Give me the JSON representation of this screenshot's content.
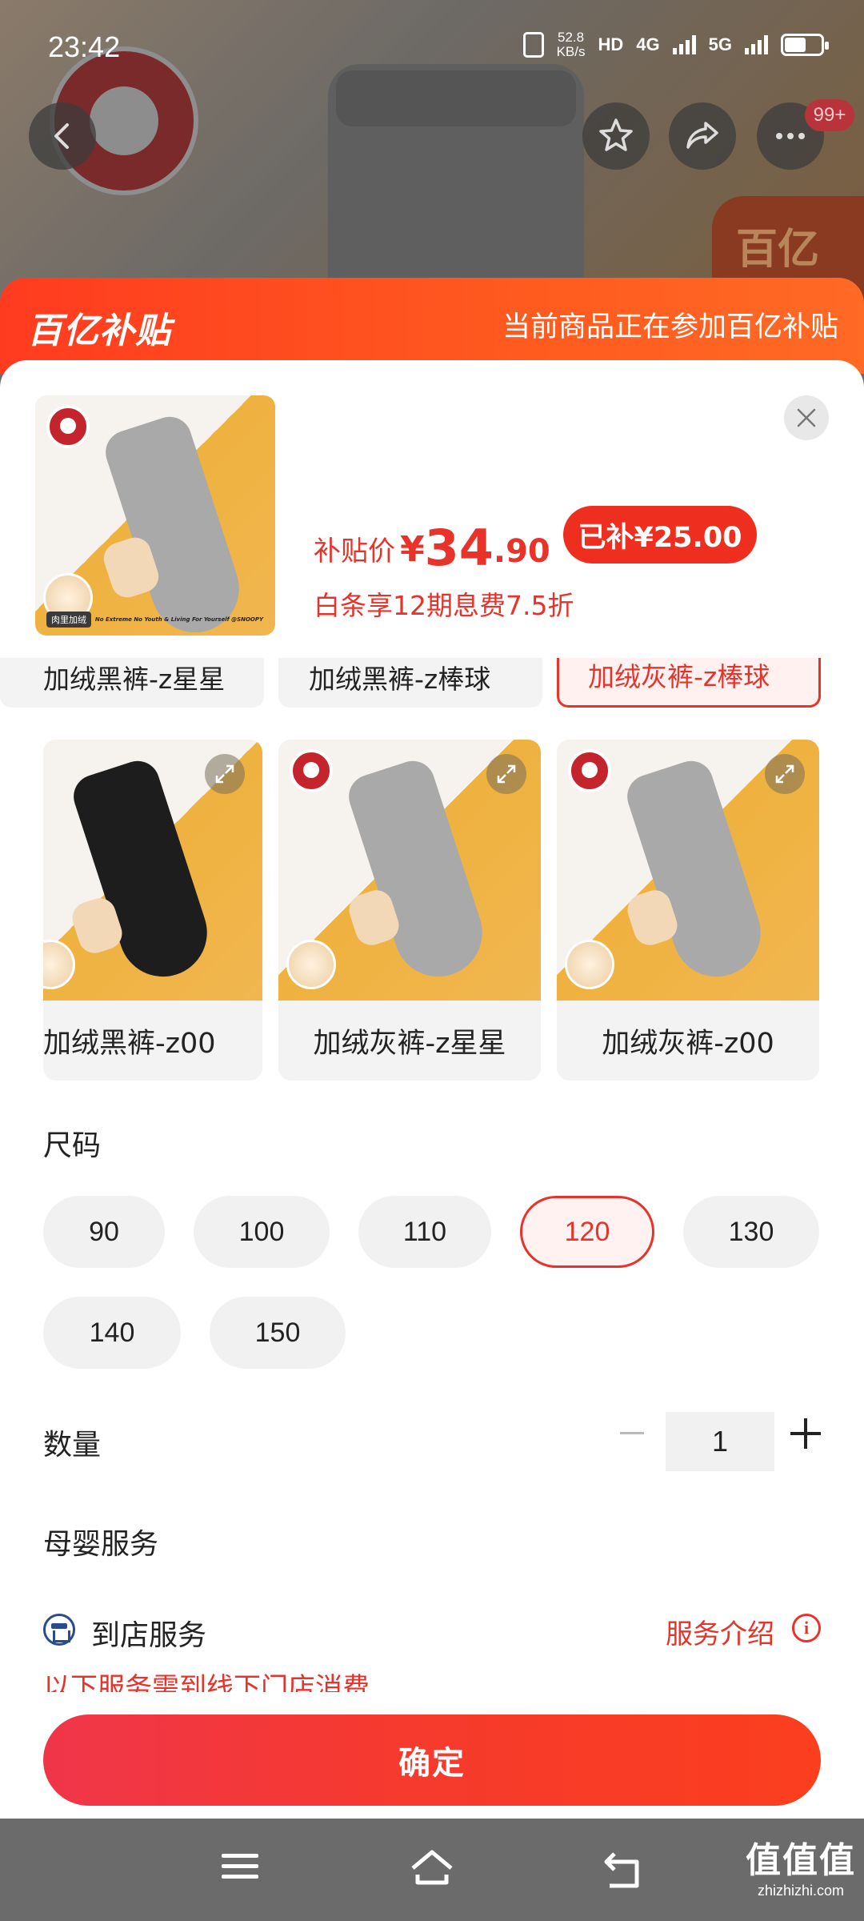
{
  "status_bar": {
    "time": "23:42",
    "net_speed_value": "52.8",
    "net_speed_unit": "KB/s",
    "hd_label": "HD",
    "net_4g": "4G",
    "net_5g": "5G"
  },
  "top_actions": {
    "message_count": "99+"
  },
  "background": {
    "badge_text": "百亿"
  },
  "banner": {
    "logo_text": "百亿补贴",
    "message": "当前商品正在参加百亿补贴"
  },
  "product": {
    "thumb_tag": "肉里加绒",
    "thumb_caption": "No Extreme No Youth & Living For Yourself @SNOOPY",
    "price_label": "补贴价",
    "currency": "¥",
    "price_int": "34",
    "price_dec": ".90",
    "subsidy": "已补¥25.00",
    "installment": "白条享12期息费7.5折"
  },
  "color_options": {
    "row1": [
      {
        "label": "加绒黑裤-z星星",
        "selected": false
      },
      {
        "label": "加绒黑裤-z棒球",
        "selected": false
      },
      {
        "label": "加绒灰裤-z棒球",
        "selected": true
      }
    ],
    "row2": [
      {
        "label": "加绒黑裤-z00",
        "selected": false
      },
      {
        "label": "加绒灰裤-z星星",
        "selected": false
      },
      {
        "label": "加绒灰裤-z00",
        "selected": false
      }
    ]
  },
  "size": {
    "title": "尺码",
    "options": [
      "90",
      "100",
      "110",
      "120",
      "130",
      "140",
      "150"
    ],
    "selected": "120"
  },
  "quantity": {
    "title": "数量",
    "value": "1"
  },
  "service": {
    "title": "母婴服务",
    "name": "到店服务",
    "link": "服务介绍",
    "info_glyph": "i",
    "note": "以下服务需到线下门店消费"
  },
  "confirm_label": "确定",
  "watermark": {
    "big": "值值值",
    "small": "zhizhizhi.com"
  },
  "colors": {
    "accent": "#e8332b",
    "banner": "#ff4a1f",
    "chip_bg": "#f1f1f1"
  }
}
